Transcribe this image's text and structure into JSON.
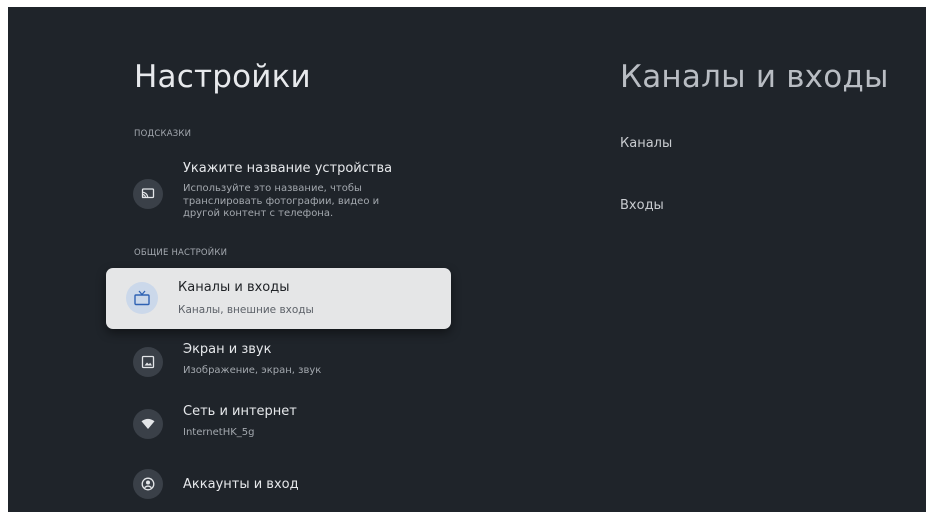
{
  "left_panel": {
    "title": "Настройки",
    "sections": {
      "hints_label": "ПОДСКАЗКИ",
      "general_label": "ОБЩИЕ НАСТРОЙКИ"
    },
    "items": [
      {
        "title": "Укажите название устройства",
        "subtitle": "Используйте это название, чтобы\nтранслировать фотографии, видео и\nдругой контент с телефона.",
        "icon": "cast-icon"
      },
      {
        "title": "Каналы и входы",
        "subtitle": "Каналы, внешние входы",
        "icon": "tv-icon",
        "selected": true
      },
      {
        "title": "Экран и звук",
        "subtitle": "Изображение, экран, звук",
        "icon": "image-icon"
      },
      {
        "title": "Сеть и интернет",
        "subtitle": "InternetHK_5g",
        "icon": "wifi-icon"
      },
      {
        "title": "Аккаунты и вход",
        "subtitle": "",
        "icon": "account-icon"
      }
    ]
  },
  "right_panel": {
    "title": "Каналы и входы",
    "items": [
      {
        "label": "Каналы"
      },
      {
        "label": "Входы"
      }
    ]
  },
  "colors": {
    "background": "#1f242a",
    "selected_card": "#e5e6e7",
    "selected_icon_bg": "#cbd8ea",
    "icon_accent": "#2f62b3"
  }
}
